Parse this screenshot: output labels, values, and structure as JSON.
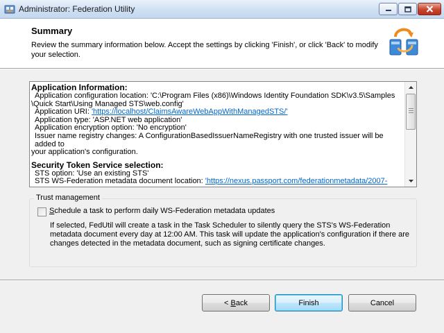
{
  "window": {
    "title": "Administrator: Federation Utility"
  },
  "header": {
    "title": "Summary",
    "description": "Review the summary information below. Accept the settings by clicking 'Finish', or click 'Back' to modify your selection."
  },
  "summary": {
    "app_info_heading": "Application Information:",
    "config_location_1": "Application configuration location: 'C:\\Program Files (x86)\\Windows Identity Foundation SDK\\v3.5\\Samples",
    "config_location_2": "\\Quick Start\\Using Managed STS\\web.config'",
    "app_uri_label": "Application URI: ",
    "app_uri_link": "'https://localhost/ClaimsAwareWebAppWithManagedSTS/'",
    "app_type": "Application type: 'ASP.NET web application'",
    "encryption": "Application encryption option: 'No encryption'",
    "issuer_registry_1": "Issuer name registry changes: A ConfigurationBasedIssuerNameRegistry with one trusted issuer will be added to",
    "issuer_registry_2": "your application's configuration.",
    "sts_heading": "Security Token Service selection:",
    "sts_option": "STS option: 'Use an existing STS'",
    "sts_metadata_label": "STS WS-Federation metadata document location: ",
    "sts_metadata_link": "'https://nexus.passport.com/federationmetadata/2007-"
  },
  "trust": {
    "group_label": "Trust management",
    "checkbox_label_prefix": "S",
    "checkbox_label_rest": "chedule a task to perform daily WS-Federation metadata updates",
    "checked": false,
    "description": "If selected, FedUtil will create a task in the Task Scheduler to silently query the STS's WS-Federation metadata document every day at 12:00 AM.  This task will update the application's configuration if there are changes detected in the metadata document, such as signing certificate changes."
  },
  "buttons": {
    "back_prefix": "< ",
    "back_accel": "B",
    "back_rest": "ack",
    "finish": "Finish",
    "cancel": "Cancel"
  },
  "icons": {
    "app": "federation-app-icon",
    "header": "federation-sync-icon",
    "minimize": "minimize-icon",
    "maximize": "maximize-icon",
    "close": "close-icon",
    "scroll_up": "scroll-up-arrow-icon",
    "scroll_down": "scroll-down-arrow-icon"
  },
  "colors": {
    "link": "#0066cc",
    "close_button": "#c8452e",
    "default_button_border": "#3c7fb1"
  }
}
